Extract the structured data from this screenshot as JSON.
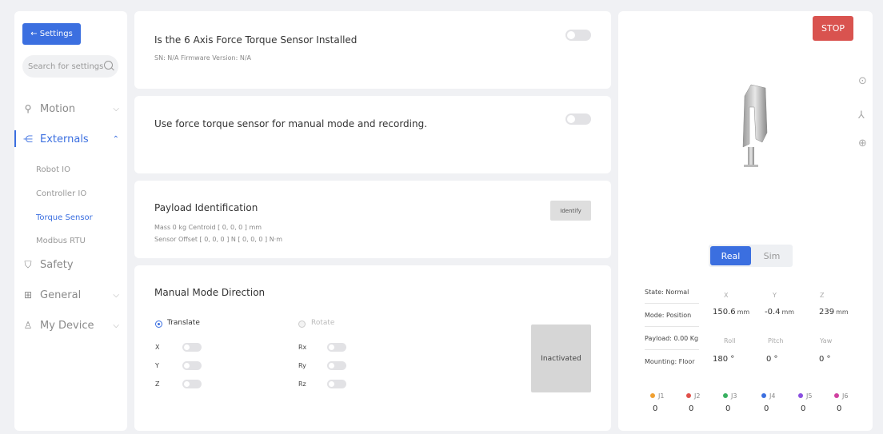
{
  "sidebar": {
    "back_label": "← Settings",
    "search_placeholder": "Search for settings",
    "nav": [
      {
        "label": "Motion",
        "icon": "motion-icon",
        "chevron": "⌵"
      },
      {
        "label": "Externals",
        "icon": "externals-icon",
        "chevron": "⌃"
      },
      {
        "label": "Safety",
        "icon": "shield-icon"
      },
      {
        "label": "General",
        "icon": "grid-icon",
        "chevron": "⌵"
      },
      {
        "label": "My Device",
        "icon": "user-icon",
        "chevron": "⌵"
      }
    ],
    "sub_items": [
      "Robot IO",
      "Controller IO",
      "Torque Sensor",
      "Modbus RTU"
    ]
  },
  "cards": {
    "sensor": {
      "title": "Is the 6 Axis Force Torque Sensor Installed",
      "sub": "SN: N/A   Firmware Version: N/A"
    },
    "manual": {
      "title": "Use force torque sensor for manual mode and recording."
    },
    "payload": {
      "title": "Payload Identification",
      "line1": "Mass 0 kg   Centroid [ 0, 0, 0 ] mm",
      "line2": "Sensor Offset [ 0, 0, 0 ] N  [ 0, 0, 0 ] N·m",
      "button": "Identify"
    },
    "direction": {
      "title": "Manual Mode Direction",
      "translate": "Translate",
      "rotate": "Rotate",
      "axes_t": [
        "X",
        "Y",
        "Z"
      ],
      "axes_r": [
        "Rx",
        "Ry",
        "Rz"
      ],
      "status": "Inactivated"
    }
  },
  "right": {
    "stop": "STOP",
    "mode_real": "Real",
    "mode_sim": "Sim",
    "info": [
      "State: Normal",
      "Mode: Position",
      "Payload: 0.00 Kg",
      "Mounting: Floor"
    ],
    "coord_heads": [
      "X",
      "Y",
      "Z",
      "Roll",
      "Pitch",
      "Yaw"
    ],
    "coord_vals": [
      {
        "v": "150.6",
        "u": "mm"
      },
      {
        "v": "-0.4",
        "u": "mm"
      },
      {
        "v": "239",
        "u": "mm"
      },
      {
        "v": "180 °",
        "u": ""
      },
      {
        "v": "0 °",
        "u": ""
      },
      {
        "v": "0 °",
        "u": ""
      }
    ],
    "joints": [
      {
        "label": "J1",
        "value": "0",
        "color": "#f0a030"
      },
      {
        "label": "J2",
        "value": "0",
        "color": "#e0504a"
      },
      {
        "label": "J3",
        "value": "0",
        "color": "#38b060"
      },
      {
        "label": "J4",
        "value": "0",
        "color": "#3b6fe0"
      },
      {
        "label": "J5",
        "value": "0",
        "color": "#8a4fe0"
      },
      {
        "label": "J6",
        "value": "0",
        "color": "#d040a0"
      }
    ],
    "side_icons": [
      "location-icon",
      "axes-icon",
      "crosshair-icon"
    ]
  },
  "colors": {
    "accent": "#3b6fe0",
    "stop": "#d9534f"
  }
}
